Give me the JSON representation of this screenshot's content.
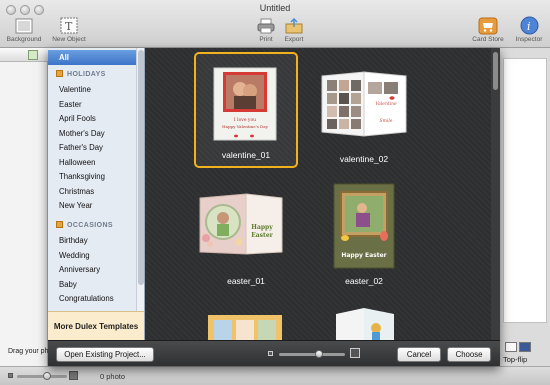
{
  "window": {
    "title": "Untitled",
    "toolbar": [
      {
        "label": "Background",
        "icon": "background-icon"
      },
      {
        "label": "New Object",
        "icon": "new-object-icon"
      },
      {
        "label": "Print",
        "icon": "printer-icon"
      },
      {
        "label": "Export",
        "icon": "export-icon"
      },
      {
        "label": "Card Store",
        "icon": "shopping-cart-icon"
      },
      {
        "label": "Inspector",
        "icon": "info-icon"
      }
    ]
  },
  "sidebar": {
    "all_label": "All",
    "sections": [
      {
        "title": "HOLIDAYS",
        "items": [
          "Valentine",
          "Easter",
          "April Fools",
          "Mother's Day",
          "Father's Day",
          "Halloween",
          "Thanksgiving",
          "Christmas",
          "New Year"
        ]
      },
      {
        "title": "OCCASIONS",
        "items": [
          "Birthday",
          "Wedding",
          "Anniversary",
          "Baby",
          "Congratulations"
        ]
      }
    ],
    "more_link": "More Dulex Templates"
  },
  "templates": [
    {
      "name": "valentine_01",
      "selected": true
    },
    {
      "name": "valentine_02",
      "selected": false
    },
    {
      "name": "easter_01",
      "selected": false
    },
    {
      "name": "easter_02",
      "selected": false
    },
    {
      "name": "",
      "selected": false
    },
    {
      "name": "",
      "selected": false
    }
  ],
  "card_art": {
    "v1_line1": "I love you",
    "v1_line2": "Happy Valentine's Day",
    "v2_text": "Valentine",
    "v2_text2": "Smile",
    "e1_line1": "Happy",
    "e1_line2": "Easter",
    "e2_text": "Happy Easter"
  },
  "buttons": {
    "open_existing": "Open Existing Project...",
    "cancel": "Cancel",
    "choose": "Choose"
  },
  "zoom_slider": {
    "value": 0.6
  },
  "background_window": {
    "drag_text": "Drag your ph",
    "top_flip": "Top-flip",
    "photo_count": "0 photo"
  },
  "colors": {
    "accent_selection": "#f2b21d",
    "sidebar_selected": "#3d74c8",
    "sheet_background": "#2f3031"
  }
}
